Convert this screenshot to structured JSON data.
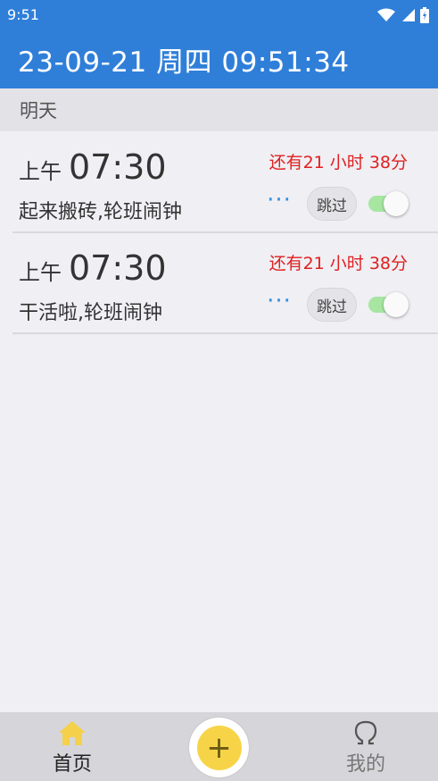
{
  "status_bar": {
    "time": "9:51"
  },
  "header": {
    "datetime": "23-09-21 周四 09:51:34"
  },
  "section": {
    "title": "明天"
  },
  "alarms": [
    {
      "period": "上午",
      "time": "07:30",
      "label": "起来搬砖,轮班闹钟",
      "remaining": "还有21 小时 38分",
      "more": "···",
      "skip": "跳过",
      "enabled": true
    },
    {
      "period": "上午",
      "time": "07:30",
      "label": "干活啦,轮班闹钟",
      "remaining": "还有21 小时 38分",
      "more": "···",
      "skip": "跳过",
      "enabled": true
    }
  ],
  "nav": {
    "home_label": "首页",
    "mine_label": "我的",
    "add_symbol": "+"
  },
  "colors": {
    "primary": "#2f7fd9",
    "remaining_text": "#e02020",
    "toggle_on": "#a6e6a1",
    "fab": "#f7d447",
    "home_icon": "#f5d04a"
  },
  "icons": {
    "wifi": "wifi-icon",
    "signal": "signal-icon",
    "battery": "battery-icon",
    "home": "home-icon",
    "mine": "omega-icon",
    "add": "plus-icon"
  }
}
